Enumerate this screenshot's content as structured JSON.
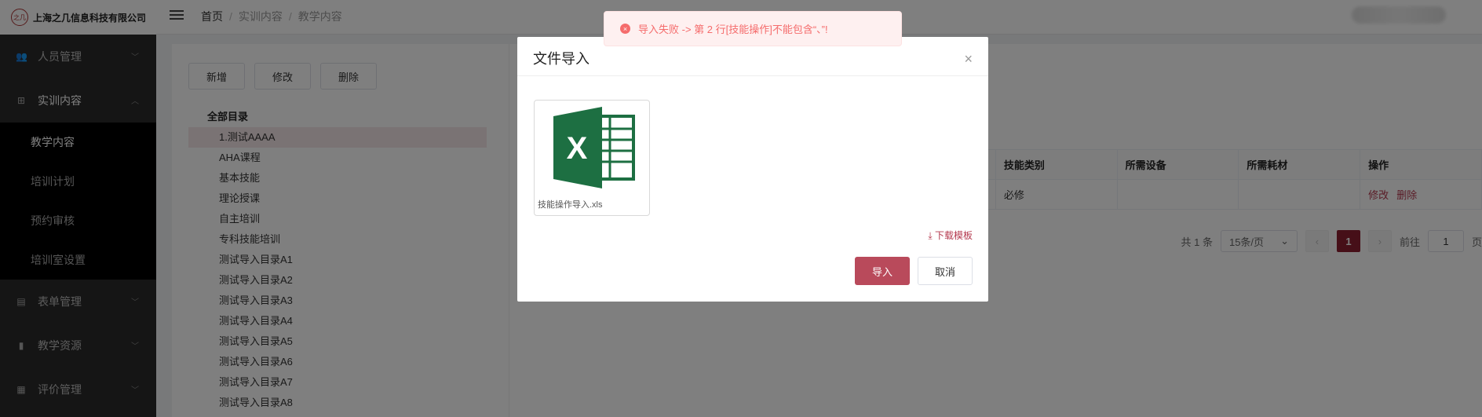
{
  "header": {
    "brand_name": "上海之几信息科技有限公司",
    "logo_text": "之几",
    "breadcrumb": [
      "首页",
      "实训内容",
      "教学内容"
    ]
  },
  "sidebar": {
    "items": [
      {
        "label": "人员管理",
        "icon": "users-icon"
      },
      {
        "label": "实训内容",
        "icon": "tree-icon"
      },
      {
        "label": "表单管理",
        "icon": "form-icon"
      },
      {
        "label": "教学资源",
        "icon": "book-icon"
      },
      {
        "label": "评价管理",
        "icon": "chart-icon"
      }
    ],
    "submenu": [
      "教学内容",
      "培训计划",
      "预约审核",
      "培训室设置"
    ]
  },
  "toolbar": {
    "add_label": "新增",
    "edit_label": "修改",
    "delete_label": "删除"
  },
  "tree": {
    "root": "全部目录",
    "nodes": [
      "1.测试AAAA",
      "AHA课程",
      "基本技能",
      "理论授课",
      "自主培训",
      "专科技能培训",
      "测试导入目录A1",
      "测试导入目录A2",
      "测试导入目录A3",
      "测试导入目录A4",
      "测试导入目录A5",
      "测试导入目录A6",
      "测试导入目录A7",
      "测试导入目录A8"
    ]
  },
  "table": {
    "headers": [
      "技能类别",
      "所需设备",
      "所需耗材",
      "操作"
    ],
    "row": {
      "category": "必修",
      "device": "",
      "supply": "",
      "edit": "修改",
      "delete": "删除"
    }
  },
  "pager": {
    "total": "共 1 条",
    "page_size": "15条/页",
    "current": "1",
    "jump_prefix": "前往",
    "jump_value": "1",
    "jump_suffix": "页",
    "prev": "‹",
    "next": "›"
  },
  "modal": {
    "title": "文件导入",
    "close": "×",
    "file_name": "技能操作导入.xls",
    "download_label": "下载模板",
    "import_label": "导入",
    "cancel_label": "取消"
  },
  "toast": {
    "message": "导入失败 -> 第 2 行[技能操作]不能包含“、”!",
    "icon_glyph": "×"
  },
  "colors": {
    "accent": "#b4394e",
    "primary_button": "#b94a5b",
    "error": "#f56c6c",
    "excel_green": "#1d6f42",
    "pager_current": "#8d1f30"
  }
}
